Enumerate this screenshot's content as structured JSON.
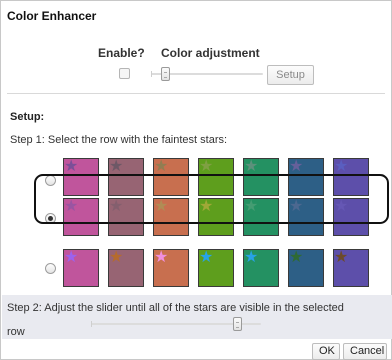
{
  "dialog": {
    "title": "Color Enhancer",
    "enable_label": "Enable?",
    "adjust_label": "Color adjustment",
    "enabled": false,
    "adjustment_level": 0.1,
    "setup_button": "Setup"
  },
  "setup": {
    "heading": "Setup:",
    "step1": "Step 1: Select the row with the faintest stars:",
    "selected_row": 1,
    "rows": [
      {
        "selected": false,
        "swatches": [
          {
            "bg": "#c0559c",
            "star": "#7c4f98"
          },
          {
            "bg": "#976473",
            "star": "#6d5866"
          },
          {
            "bg": "#c86f4f",
            "star": "#927d52"
          },
          {
            "bg": "#5e9e1d",
            "star": "#7fa043"
          },
          {
            "bg": "#249162",
            "star": "#5c917b"
          },
          {
            "bg": "#2d5f86",
            "star": "#65609a"
          },
          {
            "bg": "#5d4faa",
            "star": "#5a5ec0"
          }
        ]
      },
      {
        "selected": true,
        "swatches": [
          {
            "bg": "#c0559c",
            "star": "#9a55a2"
          },
          {
            "bg": "#976473",
            "star": "#845f6e"
          },
          {
            "bg": "#c86f4f",
            "star": "#b08c55"
          },
          {
            "bg": "#5e9e1d",
            "star": "#a0a837"
          },
          {
            "bg": "#249162",
            "star": "#449c72"
          },
          {
            "bg": "#2d5f86",
            "star": "#4c6890"
          },
          {
            "bg": "#5d4faa",
            "star": "#6557b4"
          }
        ]
      },
      {
        "selected": false,
        "swatches": [
          {
            "bg": "#c0559c",
            "star": "#9c62ee"
          },
          {
            "bg": "#976473",
            "star": "#b56b2d"
          },
          {
            "bg": "#c86f4f",
            "star": "#f08fe0"
          },
          {
            "bg": "#5e9e1d",
            "star": "#27a4e8"
          },
          {
            "bg": "#249162",
            "star": "#27a2e6"
          },
          {
            "bg": "#2d5f86",
            "star": "#2f6a34"
          },
          {
            "bg": "#5d4faa",
            "star": "#6c4a2b"
          }
        ]
      }
    ],
    "step2": "Step 2: Adjust the slider until all of the stars are visible in the selected",
    "step2_cont": "row",
    "slider_level": 0.88
  },
  "footer": {
    "ok_label": "OK",
    "cancel_label": "Cancel"
  }
}
